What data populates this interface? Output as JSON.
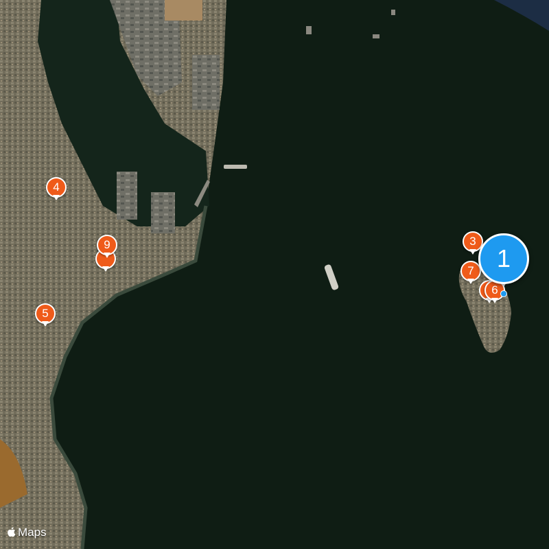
{
  "map": {
    "type": "satellite",
    "colors": {
      "sea": "#0f1d14",
      "land": "#6b6a58",
      "pin": "#ef5b1a",
      "cluster": "#1e9af0"
    }
  },
  "pins": [
    {
      "label": "4"
    },
    {
      "label": "9"
    },
    {
      "label": "5"
    },
    {
      "label": "3"
    },
    {
      "label": "7"
    },
    {
      "label": ""
    },
    {
      "label": "6"
    }
  ],
  "cluster": {
    "label": "1"
  },
  "attribution": {
    "icon": "apple-logo-icon",
    "text": "Maps"
  }
}
